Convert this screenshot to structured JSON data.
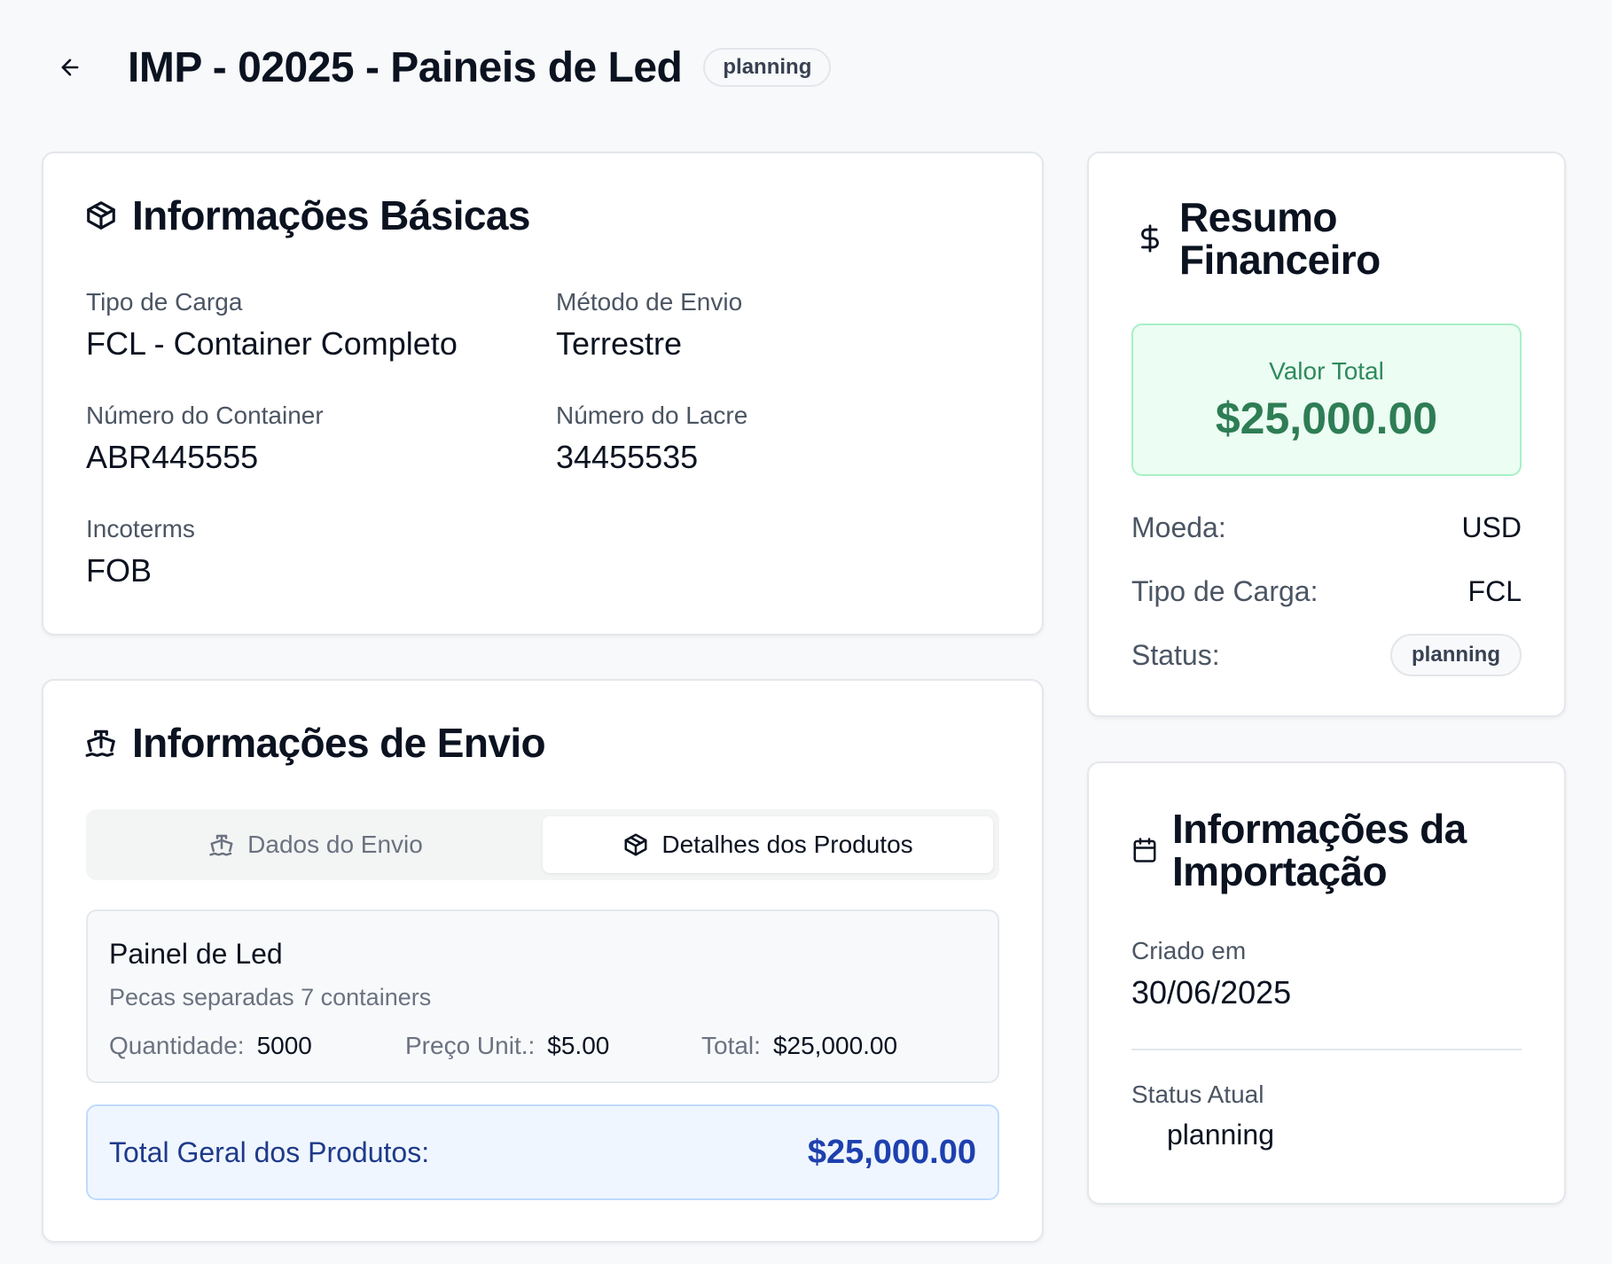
{
  "header": {
    "title": "IMP - 02025 - Paineis de Led",
    "status_badge": "planning"
  },
  "basic_info": {
    "title": "Informações Básicas",
    "fields": {
      "cargo_type": {
        "label": "Tipo de Carga",
        "value": "FCL - Container Completo"
      },
      "shipping_method": {
        "label": "Método de Envio",
        "value": "Terrestre"
      },
      "container_number": {
        "label": "Número do Container",
        "value": "ABR445555"
      },
      "seal_number": {
        "label": "Número do Lacre",
        "value": "34455535"
      },
      "incoterms": {
        "label": "Incoterms",
        "value": "FOB"
      }
    }
  },
  "shipping_info": {
    "title": "Informações de Envio",
    "tabs": [
      {
        "label": "Dados do Envio",
        "icon": "ship-icon",
        "active": false
      },
      {
        "label": "Detalhes dos Produtos",
        "icon": "package-icon",
        "active": true
      }
    ],
    "product": {
      "name": "Painel de Led",
      "description": "Pecas separadas 7 containers",
      "quantity_label": "Quantidade:",
      "quantity": "5000",
      "unit_price_label": "Preço Unit.:",
      "unit_price": "$5.00",
      "total_label": "Total:",
      "total": "$25,000.00"
    },
    "grand_total_label": "Total Geral dos Produtos:",
    "grand_total": "$25,000.00"
  },
  "financial_summary": {
    "title_line1": "Resumo",
    "title_line2": "Financeiro",
    "total_label": "Valor Total",
    "total_value": "$25,000.00",
    "rows": {
      "currency": {
        "label": "Moeda:",
        "value": "USD"
      },
      "cargo_type": {
        "label": "Tipo de Carga:",
        "value": "FCL"
      },
      "status": {
        "label": "Status:",
        "value": "planning"
      }
    }
  },
  "import_info": {
    "title_line1": "Informações da",
    "title_line2": "Importação",
    "created_label": "Criado em",
    "created_value": "30/06/2025",
    "status_label": "Status Atual",
    "status_value": "planning"
  },
  "colors": {
    "accent_green": "#2e7d55",
    "accent_blue": "#1e40af",
    "text_primary": "#0b1220",
    "text_muted": "#4b5563"
  }
}
